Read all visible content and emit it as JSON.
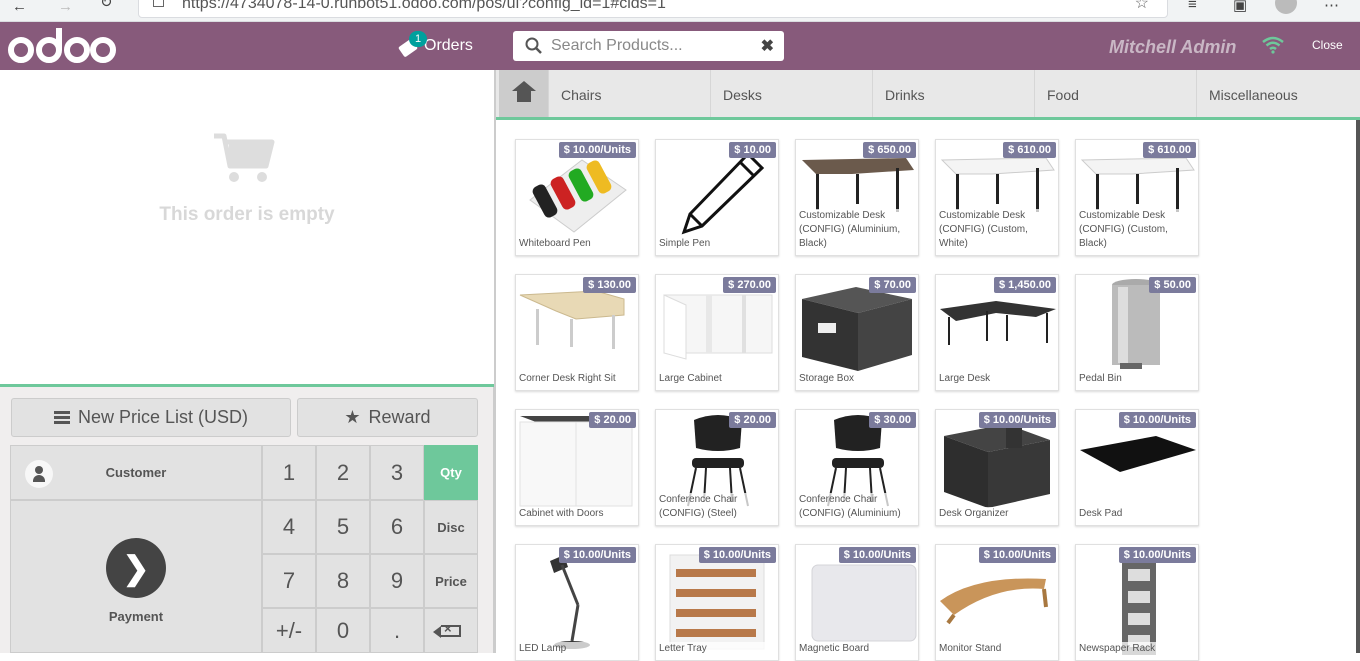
{
  "browser": {
    "url": "https://4734078-14-0.runbot51.odoo.com/pos/ui?config_id=1#cids=1"
  },
  "header": {
    "logo": "odoo",
    "orders_label": "Orders",
    "orders_count": "1",
    "search_placeholder": "Search Products...",
    "user": "Mitchell Admin",
    "close_label": "Close"
  },
  "order": {
    "empty_text": "This order is empty"
  },
  "controls": {
    "pricelist_label": "New Price List (USD)",
    "reward_label": "Reward",
    "customer_label": "Customer",
    "payment_label": "Payment"
  },
  "numpad": {
    "keys": [
      "1",
      "2",
      "3",
      "4",
      "5",
      "6",
      "7",
      "8",
      "9",
      "+/-",
      "0",
      "."
    ],
    "modes": [
      "Qty",
      "Disc",
      "Price"
    ]
  },
  "categories": [
    "Chairs",
    "Desks",
    "Drinks",
    "Food",
    "Miscellaneous"
  ],
  "products": [
    {
      "name": "Whiteboard Pen",
      "price": "$ 10.00/Units"
    },
    {
      "name": "Simple Pen",
      "price": "$ 10.00"
    },
    {
      "name": "Customizable Desk (CONFIG) (Aluminium, Black)",
      "price": "$ 650.00"
    },
    {
      "name": "Customizable Desk (CONFIG) (Custom, White)",
      "price": "$ 610.00"
    },
    {
      "name": "Customizable Desk (CONFIG) (Custom, Black)",
      "price": "$ 610.00"
    },
    {
      "name": "Corner Desk Right Sit",
      "price": "$ 130.00"
    },
    {
      "name": "Large Cabinet",
      "price": "$ 270.00"
    },
    {
      "name": "Storage Box",
      "price": "$ 70.00"
    },
    {
      "name": "Large Desk",
      "price": "$ 1,450.00"
    },
    {
      "name": "Pedal Bin",
      "price": "$ 50.00"
    },
    {
      "name": "Cabinet with Doors",
      "price": "$ 20.00"
    },
    {
      "name": "Conference Chair (CONFIG) (Steel)",
      "price": "$ 20.00"
    },
    {
      "name": "Conference Chair (CONFIG) (Aluminium)",
      "price": "$ 30.00"
    },
    {
      "name": "Desk Organizer",
      "price": "$ 10.00/Units"
    },
    {
      "name": "Desk Pad",
      "price": "$ 10.00/Units"
    },
    {
      "name": "LED Lamp",
      "price": "$ 10.00/Units"
    },
    {
      "name": "Letter Tray",
      "price": "$ 10.00/Units"
    },
    {
      "name": "Magnetic Board",
      "price": "$ 10.00/Units"
    },
    {
      "name": "Monitor Stand",
      "price": "$ 10.00/Units"
    },
    {
      "name": "Newspaper Rack",
      "price": "$ 10.00/Units"
    }
  ],
  "colors": {
    "brand": "#875a7b",
    "accent": "#6ec89b",
    "price_badge": "#7b7b9c",
    "orders_badge": "#00a09d"
  },
  "icons": {
    "cart": "shopping-cart-icon",
    "home": "home-icon",
    "wifi": "wifi-icon",
    "payment": "chevron-right-icon",
    "backspace": "backspace-icon"
  }
}
